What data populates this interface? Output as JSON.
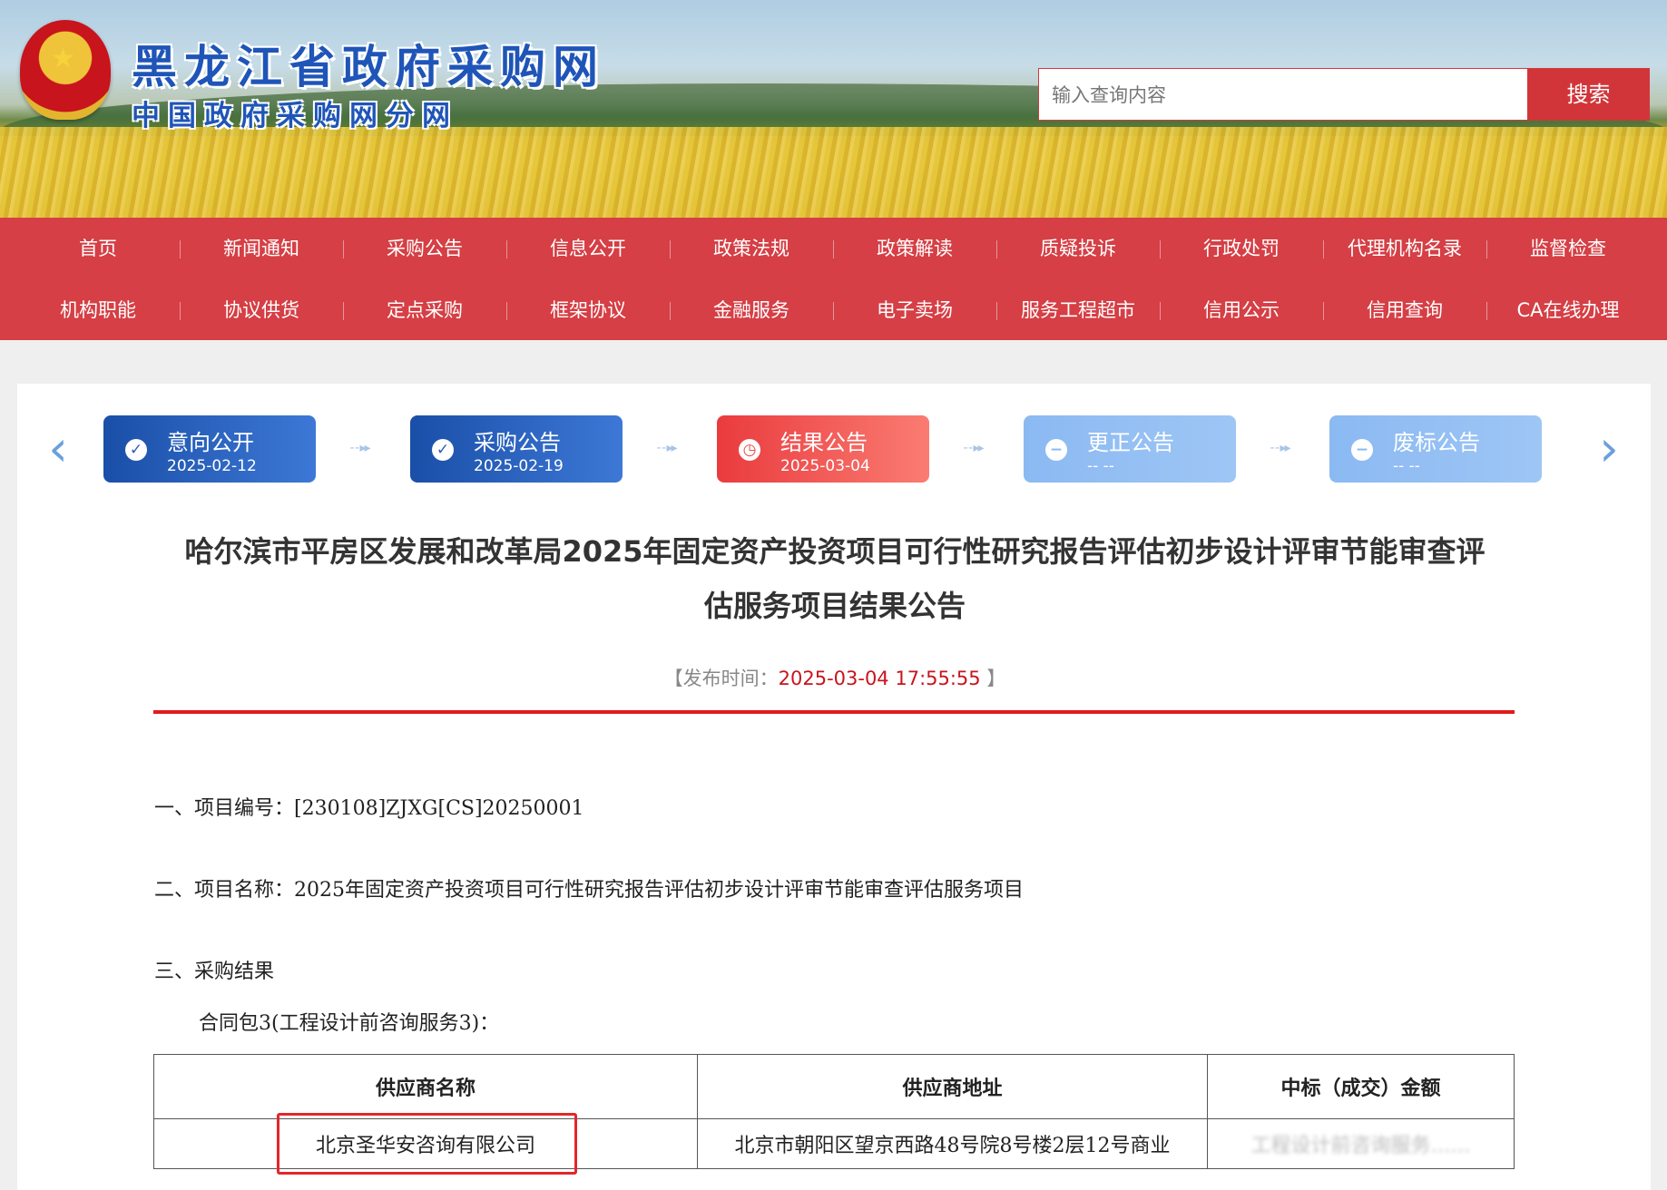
{
  "header": {
    "site_title": "黑龙江省政府采购网",
    "site_subtitle": "中国政府采购网分网",
    "search_placeholder": "输入查询内容",
    "search_button": "搜索"
  },
  "nav": {
    "row1": [
      "首页",
      "新闻通知",
      "采购公告",
      "信息公开",
      "政策法规",
      "政策解读",
      "质疑投诉",
      "行政处罚",
      "代理机构名录",
      "监督检查"
    ],
    "row2": [
      "机构职能",
      "协议供货",
      "定点采购",
      "框架协议",
      "金融服务",
      "电子卖场",
      "服务工程超市",
      "信用公示",
      "信用查询",
      "CA在线办理"
    ]
  },
  "steps": [
    {
      "label": "意向公开",
      "date": "2025-02-12",
      "state": "done",
      "icon": "check-icon"
    },
    {
      "label": "采购公告",
      "date": "2025-02-19",
      "state": "done",
      "icon": "check-icon"
    },
    {
      "label": "结果公告",
      "date": "2025-03-04",
      "state": "active",
      "icon": "clock-icon"
    },
    {
      "label": "更正公告",
      "date": "-- --",
      "state": "pending",
      "icon": "minus-icon"
    },
    {
      "label": "废标公告",
      "date": "-- --",
      "state": "pending",
      "icon": "minus-icon"
    }
  ],
  "document": {
    "title_line1": "哈尔滨市平房区发展和改革局2025年固定资产投资项目可行性研究报告评估初步设计评审节能审查评",
    "title_line2": "估服务项目结果公告",
    "publish_prefix": "【发布时间：",
    "publish_time": "2025-03-04 17:55:55",
    "publish_suffix": " 】",
    "item1": "一、项目编号：[230108]ZJXG[CS]20250001",
    "item2": "二、项目名称：2025年固定资产投资项目可行性研究报告评估初步设计评审节能审查评估服务项目",
    "item3": "三、采购结果",
    "package": "合同包3(工程设计前咨询服务3)："
  },
  "table": {
    "headers": [
      "供应商名称",
      "供应商地址",
      "中标（成交）金额"
    ],
    "rows": [
      [
        "北京圣华安咨询有限公司",
        "北京市朝阳区望京西路48号院8号楼2层12号商业",
        "工程设计前咨询服务……"
      ]
    ]
  },
  "colors": {
    "nav_red": "#d53f45",
    "accent_red": "#e01b1b",
    "step_blue": "#1a4fa8",
    "step_active": "#ea3b3e",
    "step_pending": "#8bb9f2"
  }
}
